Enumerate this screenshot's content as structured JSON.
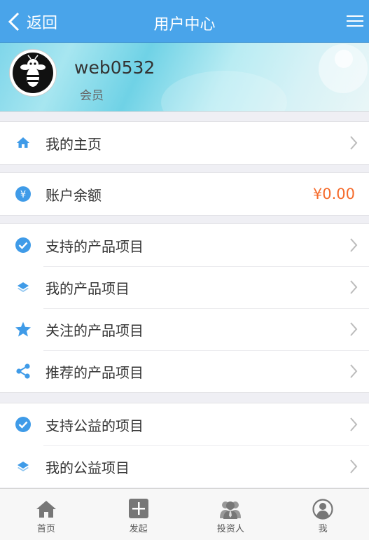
{
  "header": {
    "back_label": "返回",
    "title": "用户中心"
  },
  "profile": {
    "username": "web0532",
    "role": "会员"
  },
  "groups": {
    "home": {
      "label": "我的主页",
      "icon": "home-icon"
    },
    "balance": {
      "label": "账户余额",
      "amount": "¥0.00",
      "icon": "yen-icon"
    },
    "products": [
      {
        "label": "支持的产品项目",
        "icon": "check-circle-icon"
      },
      {
        "label": "我的产品项目",
        "icon": "layers-icon"
      },
      {
        "label": "关注的产品项目",
        "icon": "star-icon"
      },
      {
        "label": "推荐的产品项目",
        "icon": "share-icon"
      }
    ],
    "charity": [
      {
        "label": "支持公益的项目",
        "icon": "check-circle-icon"
      },
      {
        "label": "我的公益项目",
        "icon": "layers-icon"
      }
    ]
  },
  "tabbar": [
    {
      "label": "首页",
      "icon": "home-tab-icon"
    },
    {
      "label": "发起",
      "icon": "plus-tab-icon"
    },
    {
      "label": "投资人",
      "icon": "investors-tab-icon"
    },
    {
      "label": "我",
      "icon": "profile-tab-icon"
    }
  ],
  "colors": {
    "header_bg": "#49a4ea",
    "icon_blue": "#3f9be8",
    "amount": "#f56a2a",
    "tab_icon": "#777777"
  }
}
